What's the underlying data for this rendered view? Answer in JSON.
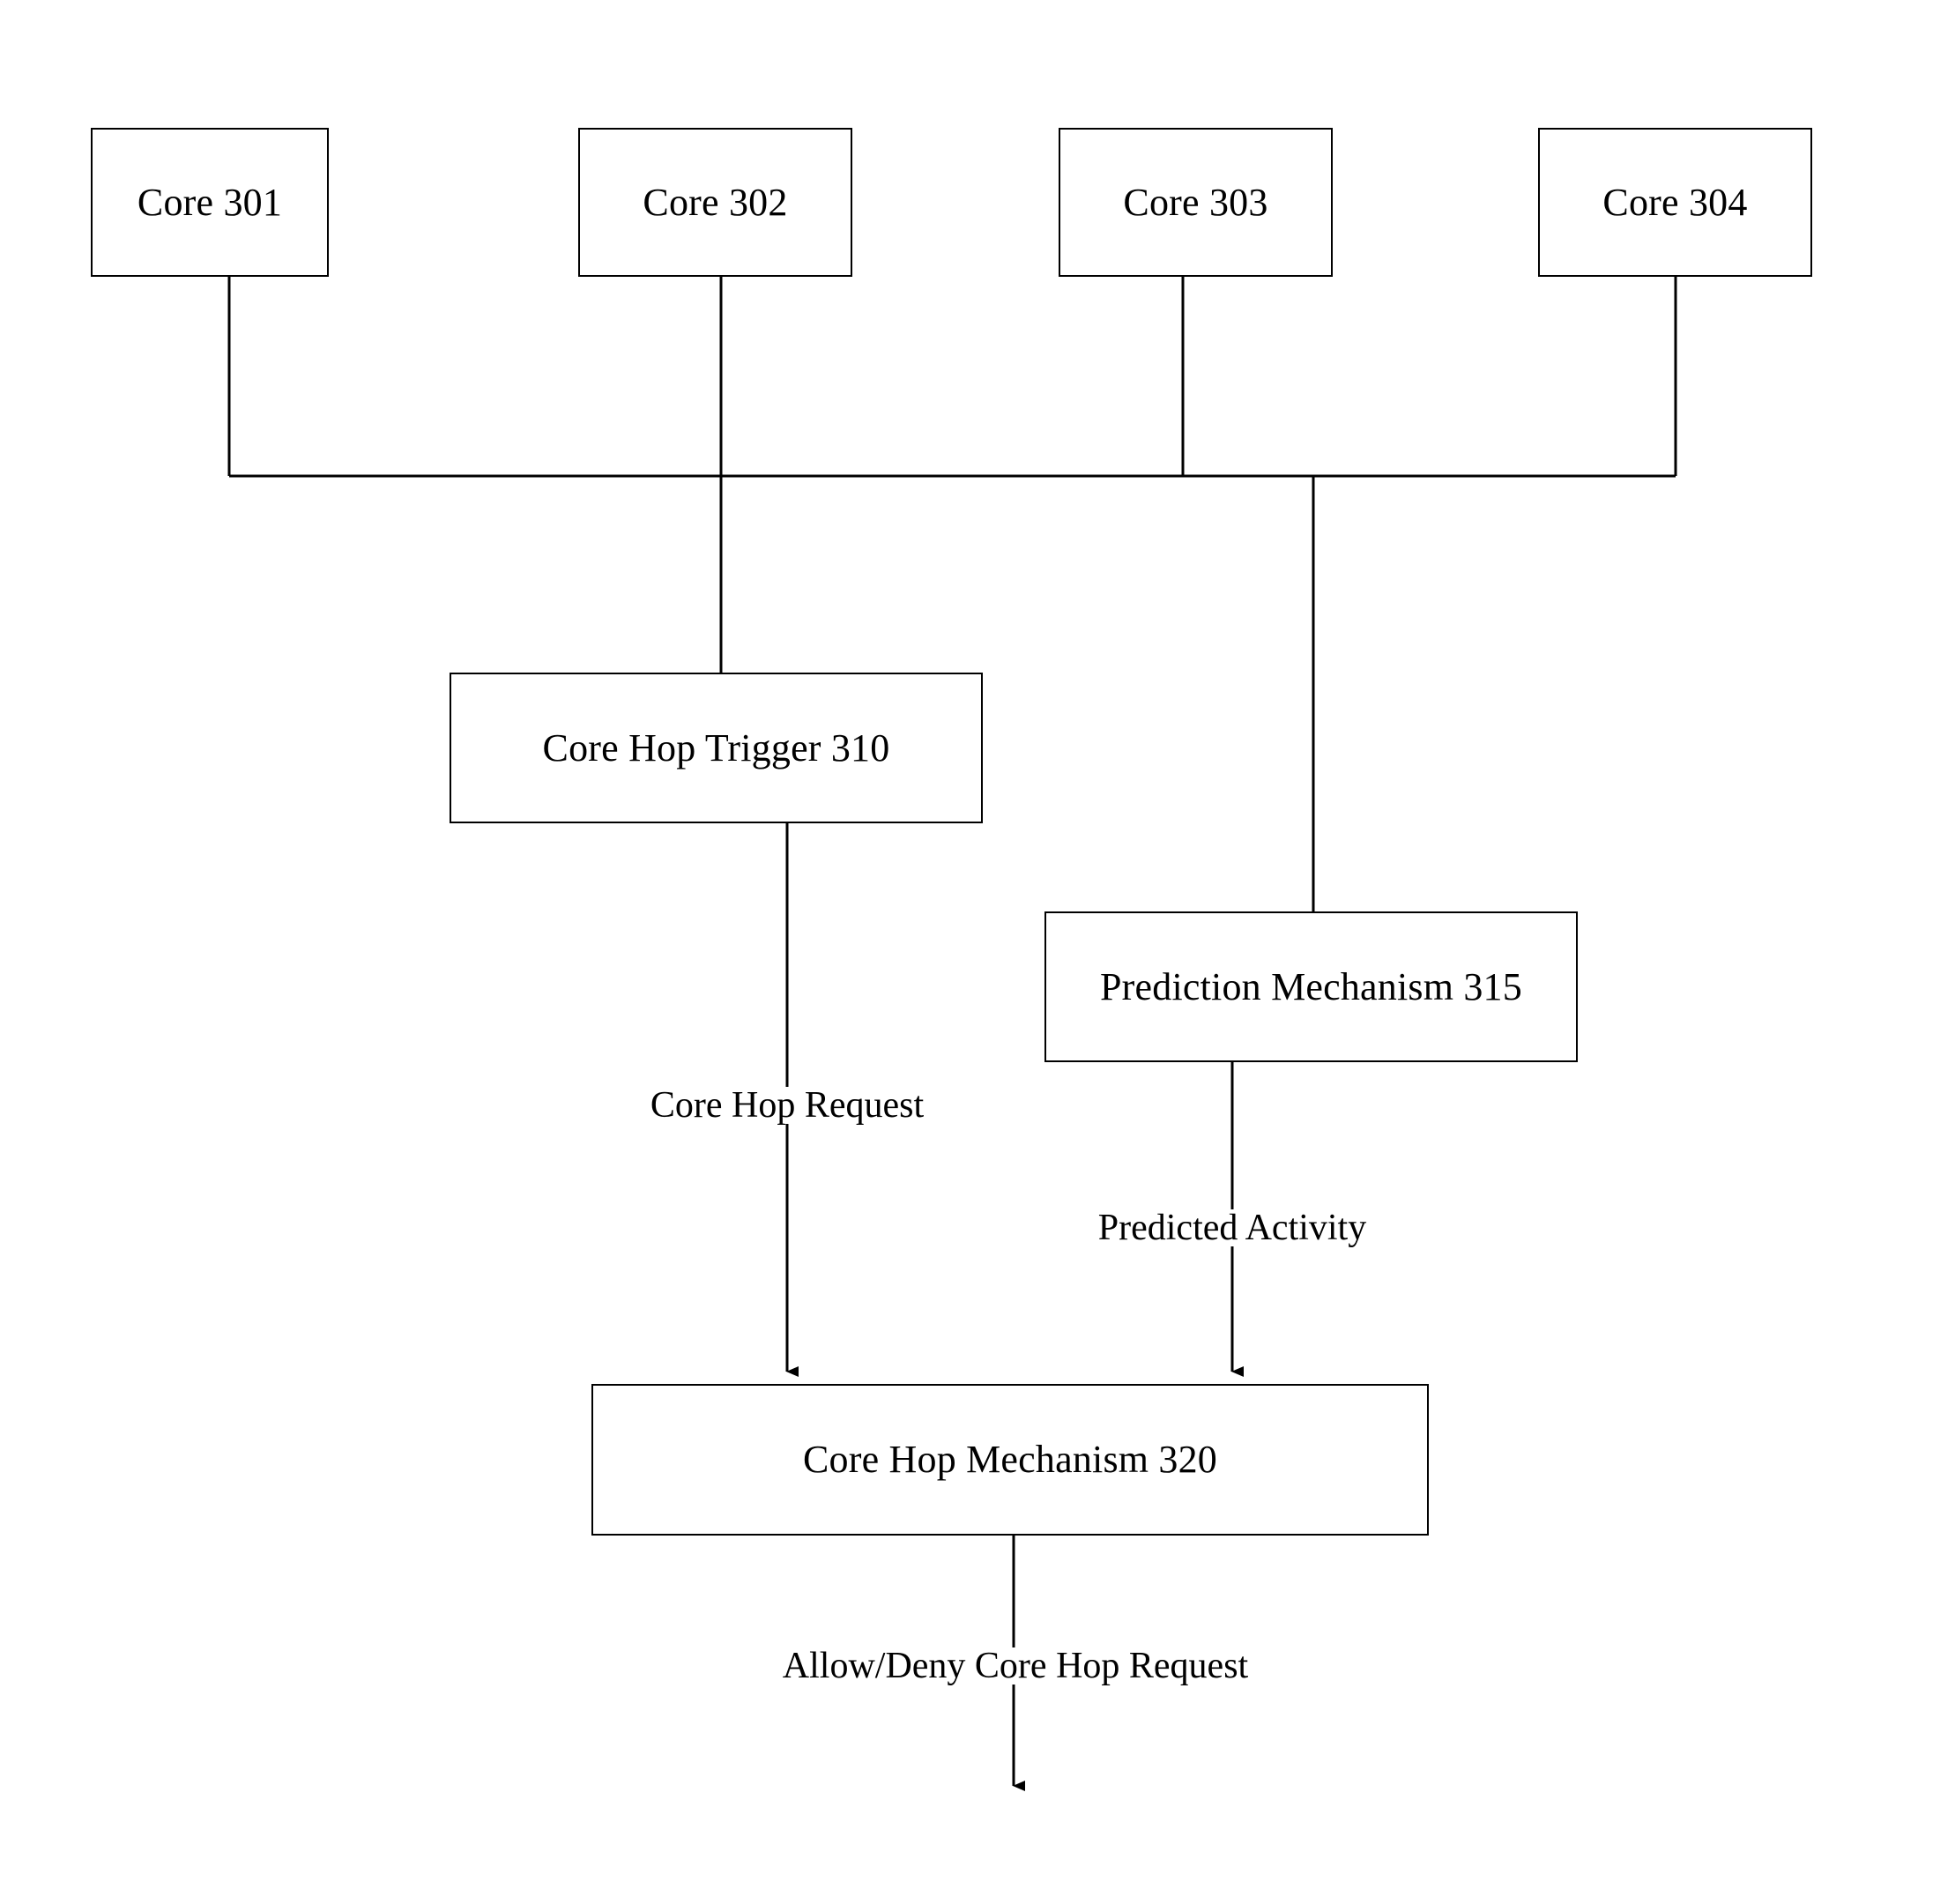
{
  "diagram": {
    "title": "Core Hop Mechanism Block Diagram",
    "figure_type": "block-diagram",
    "background_color": "#ffffff",
    "line_color": "#000000",
    "nodes": [
      {
        "id": "core301",
        "label": "Core 301"
      },
      {
        "id": "core302",
        "label": "Core 302"
      },
      {
        "id": "core303",
        "label": "Core 303"
      },
      {
        "id": "core304",
        "label": "Core 304"
      },
      {
        "id": "trigger310",
        "label": "Core Hop Trigger 310"
      },
      {
        "id": "prediction315",
        "label": "Prediction Mechanism 315"
      },
      {
        "id": "mechanism320",
        "label": "Core Hop Mechanism 320"
      }
    ],
    "edge_labels": [
      {
        "id": "core-hop-request",
        "label": "Core Hop Request"
      },
      {
        "id": "predicted-activity",
        "label": "Predicted Activity"
      },
      {
        "id": "allow-deny",
        "label": "Allow/Deny Core Hop Request"
      }
    ],
    "connections": [
      {
        "from": "core301",
        "to": "bus",
        "arrow": false
      },
      {
        "from": "core302",
        "to": "trigger310",
        "arrow": false
      },
      {
        "from": "core303",
        "to": "bus",
        "arrow": false
      },
      {
        "from": "core304",
        "to": "bus",
        "arrow": false
      },
      {
        "from": "bus",
        "to": "prediction315",
        "arrow": false
      },
      {
        "from": "trigger310",
        "to": "mechanism320",
        "arrow": true,
        "label": "Core Hop Request"
      },
      {
        "from": "prediction315",
        "to": "mechanism320",
        "arrow": true,
        "label": "Predicted Activity"
      },
      {
        "from": "mechanism320",
        "to": "output",
        "arrow": true,
        "label": "Allow/Deny Core Hop Request"
      }
    ]
  }
}
